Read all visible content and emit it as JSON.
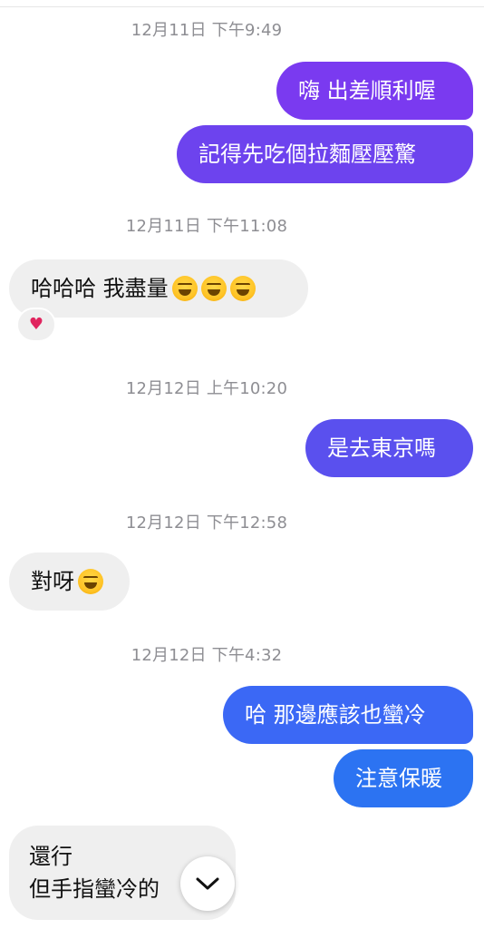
{
  "colors": {
    "outgoing_1": "#7a3af0",
    "outgoing_2": "#6d43ee",
    "outgoing_3": "#5a50ee",
    "outgoing_4": "#3b68f5",
    "outgoing_5": "#2c73f2",
    "incoming": "#efefef",
    "timestamp": "#8e8e93"
  },
  "messages": [
    {
      "type": "timestamp",
      "text": "12月11日 下午9:49"
    },
    {
      "type": "outgoing",
      "text": "嗨 出差順利喔"
    },
    {
      "type": "outgoing",
      "text": "記得先吃個拉麵壓壓驚"
    },
    {
      "type": "timestamp",
      "text": "12月11日 下午11:08"
    },
    {
      "type": "incoming",
      "text": "哈哈哈 我盡量",
      "emoji": "laughing-face-emoji",
      "emoji_count": 3,
      "reaction": "heart"
    },
    {
      "type": "timestamp",
      "text": "12月12日 上午10:20"
    },
    {
      "type": "outgoing",
      "text": "是去東京嗎"
    },
    {
      "type": "timestamp",
      "text": "12月12日 下午12:58"
    },
    {
      "type": "incoming",
      "text": "對呀",
      "emoji": "laughing-face-emoji",
      "emoji_count": 1
    },
    {
      "type": "timestamp",
      "text": "12月12日 下午4:32"
    },
    {
      "type": "outgoing",
      "text": "哈 那邊應該也蠻冷"
    },
    {
      "type": "outgoing",
      "text": "注意保暖"
    },
    {
      "type": "incoming",
      "line1": "還行",
      "line2": "但手指蠻冷的"
    }
  ],
  "reaction_icon": "heart-icon",
  "reaction_glyph": "♥",
  "scroll_button_icon": "chevron-down-icon"
}
